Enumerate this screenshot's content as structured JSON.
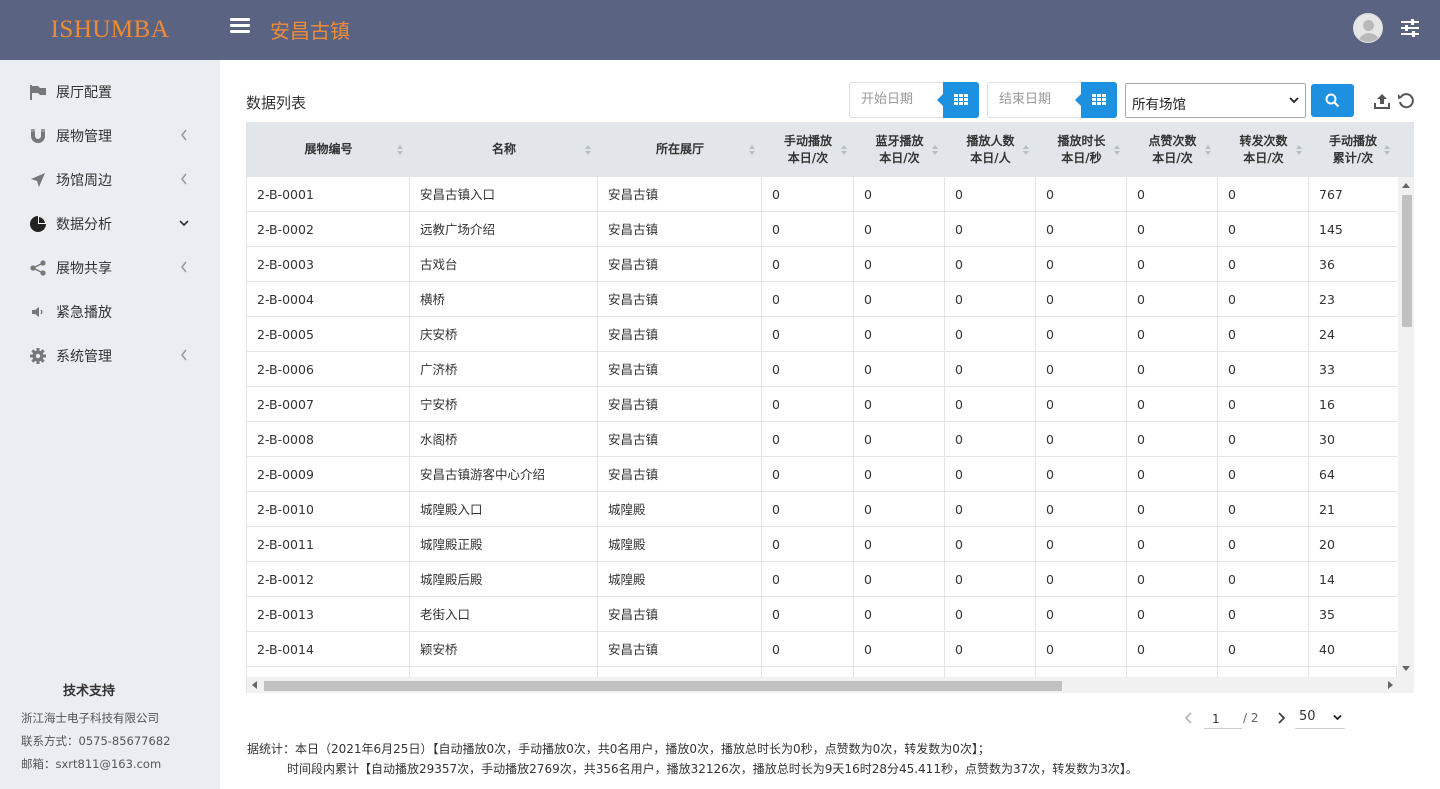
{
  "header": {
    "logo": "ISHUMBA",
    "title": "安昌古镇"
  },
  "sidebar": {
    "items": [
      {
        "label": "展厅配置",
        "icon": "flag-icon",
        "has_arrow": false
      },
      {
        "label": "展物管理",
        "icon": "magnet-icon",
        "has_arrow": true
      },
      {
        "label": "场馆周边",
        "icon": "location-arrow-icon",
        "has_arrow": true
      },
      {
        "label": "数据分析",
        "icon": "pie-chart-icon",
        "has_arrow": true,
        "expanded": true
      },
      {
        "label": "展物共享",
        "icon": "share-icon",
        "has_arrow": true
      },
      {
        "label": "紧急播放",
        "icon": "speaker-icon",
        "has_arrow": false
      },
      {
        "label": "系统管理",
        "icon": "gear-icon",
        "has_arrow": true
      }
    ],
    "support": {
      "title": "技术支持",
      "company": "浙江海士电子科技有限公司",
      "contact": "联系方式：0575-85677682",
      "email": "邮箱：sxrt811@163.com"
    }
  },
  "toolbar": {
    "list_title": "数据列表",
    "start_date_placeholder": "开始日期",
    "end_date_placeholder": "结束日期",
    "venue_selected": "所有场馆"
  },
  "table": {
    "columns": [
      [
        "展物编号"
      ],
      [
        "名称"
      ],
      [
        "所在展厅"
      ],
      [
        "手动播放",
        "本日/次"
      ],
      [
        "蓝牙播放",
        "本日/次"
      ],
      [
        "播放人数",
        "本日/人"
      ],
      [
        "播放时长",
        "本日/秒"
      ],
      [
        "点赞次数",
        "本日/次"
      ],
      [
        "转发次数",
        "本日/次"
      ],
      [
        "手动播放",
        "累计/次"
      ]
    ],
    "rows": [
      [
        "2-B-0001",
        "安昌古镇入口",
        "安昌古镇",
        "0",
        "0",
        "0",
        "0",
        "0",
        "0",
        "767"
      ],
      [
        "2-B-0002",
        "远教广场介绍",
        "安昌古镇",
        "0",
        "0",
        "0",
        "0",
        "0",
        "0",
        "145"
      ],
      [
        "2-B-0003",
        "古戏台",
        "安昌古镇",
        "0",
        "0",
        "0",
        "0",
        "0",
        "0",
        "36"
      ],
      [
        "2-B-0004",
        "横桥",
        "安昌古镇",
        "0",
        "0",
        "0",
        "0",
        "0",
        "0",
        "23"
      ],
      [
        "2-B-0005",
        "庆安桥",
        "安昌古镇",
        "0",
        "0",
        "0",
        "0",
        "0",
        "0",
        "24"
      ],
      [
        "2-B-0006",
        "广济桥",
        "安昌古镇",
        "0",
        "0",
        "0",
        "0",
        "0",
        "0",
        "33"
      ],
      [
        "2-B-0007",
        "宁安桥",
        "安昌古镇",
        "0",
        "0",
        "0",
        "0",
        "0",
        "0",
        "16"
      ],
      [
        "2-B-0008",
        "水阁桥",
        "安昌古镇",
        "0",
        "0",
        "0",
        "0",
        "0",
        "0",
        "30"
      ],
      [
        "2-B-0009",
        "安昌古镇游客中心介绍",
        "安昌古镇",
        "0",
        "0",
        "0",
        "0",
        "0",
        "0",
        "64"
      ],
      [
        "2-B-0010",
        "城隍殿入口",
        "城隍殿",
        "0",
        "0",
        "0",
        "0",
        "0",
        "0",
        "21"
      ],
      [
        "2-B-0011",
        "城隍殿正殿",
        "城隍殿",
        "0",
        "0",
        "0",
        "0",
        "0",
        "0",
        "20"
      ],
      [
        "2-B-0012",
        "城隍殿后殿",
        "城隍殿",
        "0",
        "0",
        "0",
        "0",
        "0",
        "0",
        "14"
      ],
      [
        "2-B-0013",
        "老街入口",
        "安昌古镇",
        "0",
        "0",
        "0",
        "0",
        "0",
        "0",
        "35"
      ],
      [
        "2-B-0014",
        "颖安桥",
        "安昌古镇",
        "0",
        "0",
        "0",
        "0",
        "0",
        "0",
        "40"
      ]
    ]
  },
  "pagination": {
    "current_page": "1",
    "total_pages": "/ 2",
    "page_size": "50"
  },
  "stats": {
    "today": "据统计：本日（2021年6月25日）【自动播放0次，手动播放0次，共0名用户，播放0次，播放总时长为0秒，点赞数为0次，转发数为0次】；",
    "period": "时间段内累计【自动播放29357次，手动播放2769次，共356名用户，播放32126次，播放总时长为9天16时28分45.411秒，点赞数为37次，转发数为3次】。"
  },
  "colors": {
    "header_bg": "#5b6382",
    "accent_orange": "#f08a35",
    "primary_blue": "#1e90e0",
    "sidebar_bg": "#eaedf1",
    "table_header_bg": "#e2e6ea"
  }
}
